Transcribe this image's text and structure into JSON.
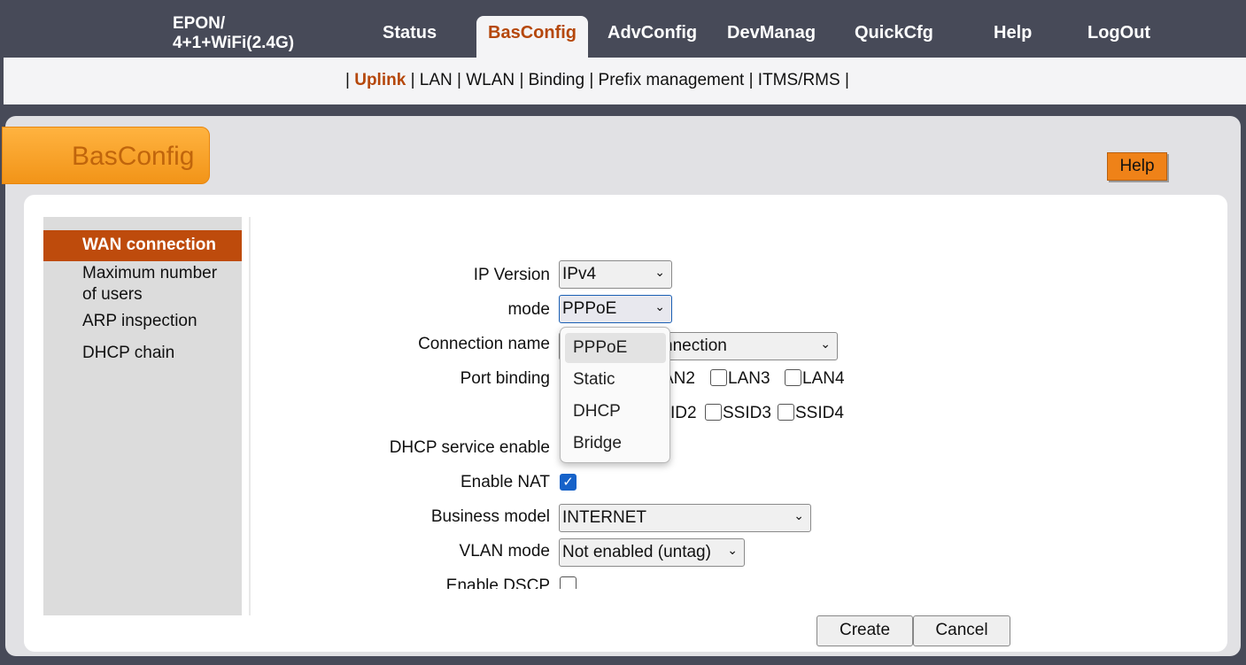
{
  "device": {
    "line1": "EPON/",
    "line2": "4+1+WiFi(2.4G)"
  },
  "nav": {
    "status": "Status",
    "basconfig": "BasConfig",
    "advconfig": "AdvConfig",
    "devmanag": "DevManag",
    "quickcfg": "QuickCfg",
    "help": "Help",
    "logout": "LogOut"
  },
  "subnav": {
    "sep": "|",
    "uplink": "Uplink",
    "lan": "LAN",
    "wlan": "WLAN",
    "binding": "Binding",
    "prefix": "Prefix management",
    "itms": "ITMS/RMS"
  },
  "section_title": "BasConfig",
  "help_button": "Help",
  "sidebar": {
    "wan": "WAN connection",
    "maxusers_1": "Maximum number",
    "maxusers_2": "of users",
    "arp": "ARP inspection",
    "dhcp": "DHCP chain"
  },
  "form": {
    "ip_version_label": "IP Version",
    "ip_version_value": "IPv4",
    "mode_label": "mode",
    "mode_value": "PPPoE",
    "conn_name_label": "Connection name",
    "conn_name_value": "nnection",
    "port_binding_label": "Port binding",
    "lan2": "AN2",
    "lan3": "LAN3",
    "lan4": "LAN4",
    "ssid2": "ID2",
    "ssid3": "SSID3",
    "ssid4": "SSID4",
    "dhcp_label": "DHCP service enable",
    "nat_label": "Enable NAT",
    "business_label": "Business model",
    "business_value": "INTERNET",
    "vlan_label": "VLAN mode",
    "vlan_value": "Not enabled (untag)",
    "dscp_label": "Enable DSCP"
  },
  "mode_options": [
    "PPPoE",
    "Static",
    "DHCP",
    "Bridge"
  ],
  "buttons": {
    "create": "Create",
    "cancel": "Cancel"
  },
  "colors": {
    "accent": "#be4b0c",
    "nav_bg": "#474a58",
    "checkbox": "#1662c9"
  }
}
